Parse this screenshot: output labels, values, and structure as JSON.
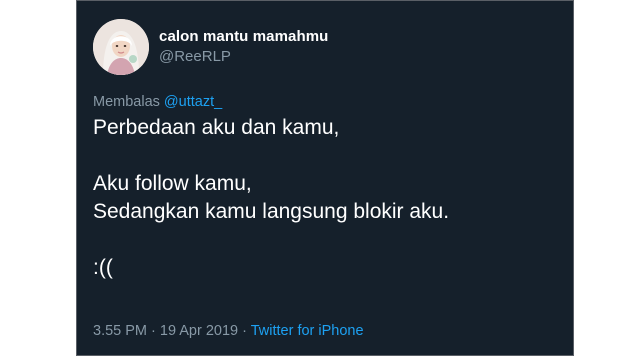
{
  "tweet": {
    "display_name": "calon mantu mamahmu",
    "handle": "@ReeRLP",
    "reply_prefix": "Membalas",
    "reply_to": "@uttazt_",
    "lines": [
      "Perbedaan aku dan kamu,",
      "Aku follow kamu,",
      "Sedangkan kamu langsung blokir aku.",
      ":(("
    ],
    "time": "3.55 PM",
    "separator_1": " · ",
    "date": "19 Apr 2019",
    "separator_2": " · ",
    "source": "Twitter for iPhone"
  },
  "colors": {
    "background": "#15202b",
    "text": "#ffffff",
    "muted": "#8899a6",
    "link": "#1da1f2"
  }
}
